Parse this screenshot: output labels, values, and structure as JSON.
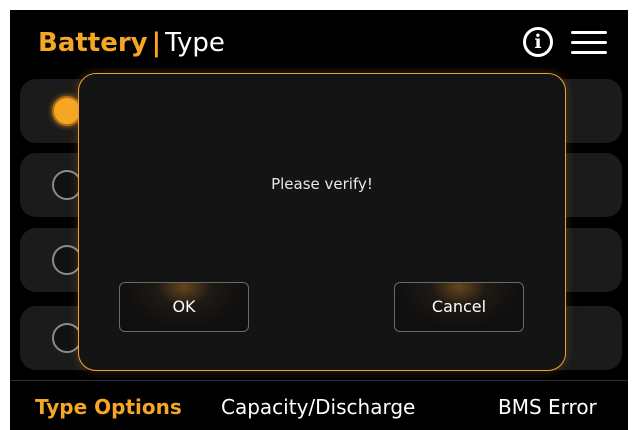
{
  "header": {
    "title_main": "Battery",
    "title_separator": "|",
    "title_sub": "Type",
    "info_icon": "info-circle-icon",
    "menu_icon": "hamburger-menu-icon"
  },
  "options": {
    "selected_index": 0,
    "count": 4
  },
  "dialog": {
    "message": "Please verify!",
    "ok_label": "OK",
    "cancel_label": "Cancel"
  },
  "tabs": [
    {
      "label": "Type Options",
      "active": true
    },
    {
      "label": "Capacity/Discharge",
      "active": false
    },
    {
      "label": "BMS Error",
      "active": false
    }
  ],
  "colors": {
    "accent": "#f5a623",
    "background": "#000000",
    "row": "#1b1b1b",
    "dialog_border": "#f0a030"
  }
}
